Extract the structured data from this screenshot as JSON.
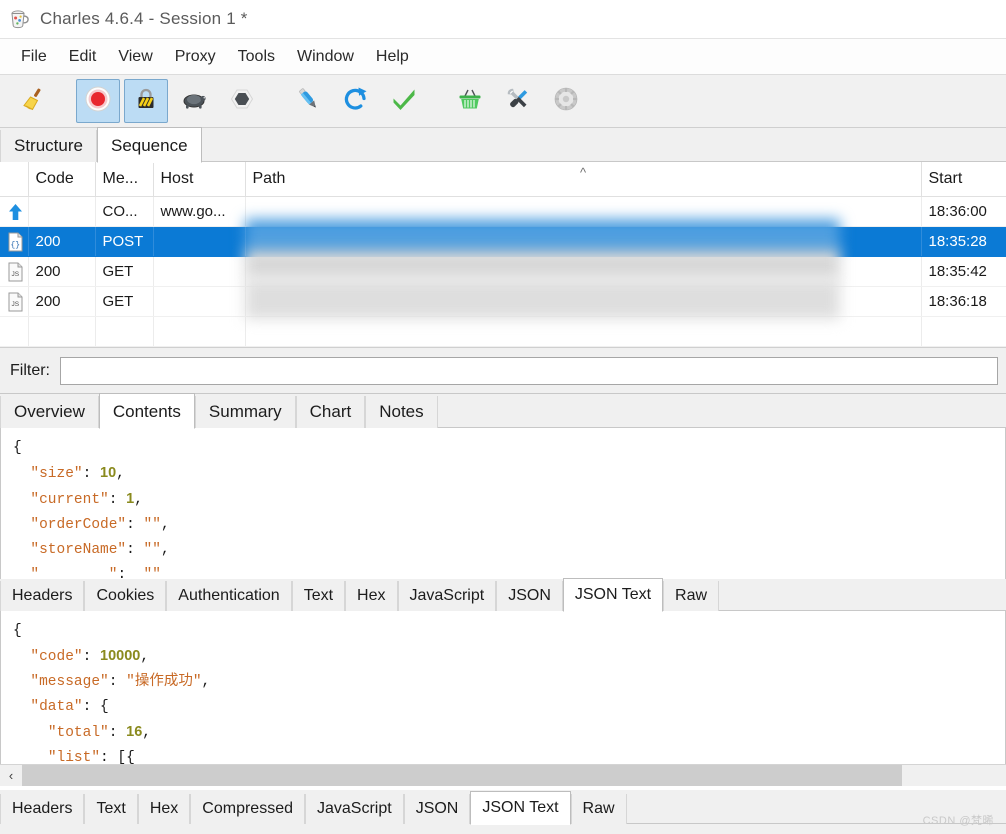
{
  "window": {
    "title": "Charles 4.6.4 - Session 1 *",
    "app_icon": "charles-jug-icon"
  },
  "menubar": {
    "items": [
      {
        "label": "File"
      },
      {
        "label": "Edit"
      },
      {
        "label": "View"
      },
      {
        "label": "Proxy"
      },
      {
        "label": "Tools"
      },
      {
        "label": "Window"
      },
      {
        "label": "Help"
      }
    ]
  },
  "toolbar": {
    "buttons": [
      {
        "name": "clear-session-icon",
        "title": "Clear Session",
        "active": false
      },
      {
        "name": "record-icon",
        "title": "Start/Stop Recording",
        "active": true
      },
      {
        "name": "throttle-lock-icon",
        "title": "Start/Stop Throttling",
        "active": true
      },
      {
        "name": "turtle-icon",
        "title": "Throttle Settings",
        "active": false
      },
      {
        "name": "breakpoint-hexagon-icon",
        "title": "Enable/Disable Breakpoints",
        "active": false
      },
      {
        "name": "compose-pen-icon",
        "title": "Compose a new request",
        "active": false
      },
      {
        "name": "repeat-refresh-icon",
        "title": "Repeat the request",
        "active": false
      },
      {
        "name": "validate-check-icon",
        "title": "Validate",
        "active": false
      },
      {
        "name": "basket-icon",
        "title": "Tools",
        "active": false
      },
      {
        "name": "tools-wrench-icon",
        "title": "Settings",
        "active": false
      },
      {
        "name": "gear-icon",
        "title": "Preferences",
        "active": false
      }
    ]
  },
  "view_tabs": {
    "items": [
      {
        "label": "Structure",
        "selected": false
      },
      {
        "label": "Sequence",
        "selected": true
      }
    ]
  },
  "session_table": {
    "columns": [
      "",
      "Code",
      "Me...",
      "Host",
      "Path",
      "Start"
    ],
    "sorted_column": "Path",
    "sort_direction": "ascending",
    "rows": [
      {
        "icon": "upload-arrow-icon",
        "code": "",
        "method": "CO...",
        "host": "www.go...",
        "path": "",
        "start": "18:36:00",
        "selected": false,
        "redacted": false
      },
      {
        "icon": "json-file-icon",
        "code": "200",
        "method": "POST",
        "host": "",
        "path": "",
        "start": "18:35:28",
        "selected": true,
        "redacted": true
      },
      {
        "icon": "js-file-icon",
        "code": "200",
        "method": "GET",
        "host": "",
        "path": "",
        "start": "18:35:42",
        "selected": false,
        "redacted": true
      },
      {
        "icon": "js-file-icon",
        "code": "200",
        "method": "GET",
        "host": "",
        "path": "",
        "start": "18:36:18",
        "selected": false,
        "redacted": true
      }
    ]
  },
  "filter": {
    "label": "Filter:",
    "value": "",
    "placeholder": ""
  },
  "request_section": {
    "tabs": [
      {
        "label": "Overview",
        "selected": false
      },
      {
        "label": "Contents",
        "selected": true
      },
      {
        "label": "Summary",
        "selected": false
      },
      {
        "label": "Chart",
        "selected": false
      },
      {
        "label": "Notes",
        "selected": false
      }
    ],
    "body_tabs": [
      {
        "label": "Headers",
        "selected": false
      },
      {
        "label": "Cookies",
        "selected": false
      },
      {
        "label": "Authentication",
        "selected": false
      },
      {
        "label": "Text",
        "selected": false
      },
      {
        "label": "Hex",
        "selected": false
      },
      {
        "label": "JavaScript",
        "selected": false
      },
      {
        "label": "JSON",
        "selected": false
      },
      {
        "label": "JSON Text",
        "selected": true
      },
      {
        "label": "Raw",
        "selected": false
      }
    ],
    "code_lines": [
      [
        {
          "t": "{",
          "c": "p"
        }
      ],
      [
        {
          "t": "  ",
          "c": "p"
        },
        {
          "t": "\"size\"",
          "c": "k"
        },
        {
          "t": ": ",
          "c": "p"
        },
        {
          "t": "10",
          "c": "n"
        },
        {
          "t": ",",
          "c": "p"
        }
      ],
      [
        {
          "t": "  ",
          "c": "p"
        },
        {
          "t": "\"current\"",
          "c": "k"
        },
        {
          "t": ": ",
          "c": "p"
        },
        {
          "t": "1",
          "c": "n"
        },
        {
          "t": ",",
          "c": "p"
        }
      ],
      [
        {
          "t": "  ",
          "c": "p"
        },
        {
          "t": "\"orderCode\"",
          "c": "k"
        },
        {
          "t": ": ",
          "c": "p"
        },
        {
          "t": "\"\"",
          "c": "s"
        },
        {
          "t": ",",
          "c": "p"
        }
      ],
      [
        {
          "t": "  ",
          "c": "p"
        },
        {
          "t": "\"storeName\"",
          "c": "k"
        },
        {
          "t": ": ",
          "c": "p"
        },
        {
          "t": "\"\"",
          "c": "s"
        },
        {
          "t": ",",
          "c": "p"
        }
      ],
      [
        {
          "t": "  ",
          "c": "p"
        },
        {
          "t": "\"",
          "c": "k"
        },
        {
          "t": "         ",
          "c": "p"
        },
        {
          "t": "\"",
          "c": "k"
        },
        {
          "t": ": ",
          "c": "p"
        },
        {
          "t": "\"\"",
          "c": "s"
        }
      ]
    ]
  },
  "response_section": {
    "body_tabs": [
      {
        "label": "Headers",
        "selected": false
      },
      {
        "label": "Text",
        "selected": false
      },
      {
        "label": "Hex",
        "selected": false
      },
      {
        "label": "Compressed",
        "selected": false
      },
      {
        "label": "JavaScript",
        "selected": false
      },
      {
        "label": "JSON",
        "selected": false
      },
      {
        "label": "JSON Text",
        "selected": true
      },
      {
        "label": "Raw",
        "selected": false
      }
    ],
    "code_lines": [
      [
        {
          "t": "{",
          "c": "p"
        }
      ],
      [
        {
          "t": "  ",
          "c": "p"
        },
        {
          "t": "\"code\"",
          "c": "k"
        },
        {
          "t": ": ",
          "c": "p"
        },
        {
          "t": "10000",
          "c": "n"
        },
        {
          "t": ",",
          "c": "p"
        }
      ],
      [
        {
          "t": "  ",
          "c": "p"
        },
        {
          "t": "\"message\"",
          "c": "k"
        },
        {
          "t": ": ",
          "c": "p"
        },
        {
          "t": "\"操作成功\"",
          "c": "s"
        },
        {
          "t": ",",
          "c": "p"
        }
      ],
      [
        {
          "t": "  ",
          "c": "p"
        },
        {
          "t": "\"data\"",
          "c": "k"
        },
        {
          "t": ": ",
          "c": "p"
        },
        {
          "t": "{",
          "c": "p"
        }
      ],
      [
        {
          "t": "    ",
          "c": "p"
        },
        {
          "t": "\"total\"",
          "c": "k"
        },
        {
          "t": ": ",
          "c": "p"
        },
        {
          "t": "16",
          "c": "n"
        },
        {
          "t": ",",
          "c": "p"
        }
      ],
      [
        {
          "t": "    ",
          "c": "p"
        },
        {
          "t": "\"list\"",
          "c": "k"
        },
        {
          "t": ": ",
          "c": "p"
        },
        {
          "t": "[{",
          "c": "p"
        }
      ]
    ],
    "scrollbar": {
      "left_arrow": "‹"
    }
  },
  "watermark": {
    "text": "CSDN @梵晞"
  },
  "colors": {
    "selection_blue": "#0b7ad5",
    "toolbar_active": "#bcdcf4",
    "json_key": "#c86a26",
    "json_number": "#8a8a1e",
    "panel_gray": "#f0f0f0"
  }
}
